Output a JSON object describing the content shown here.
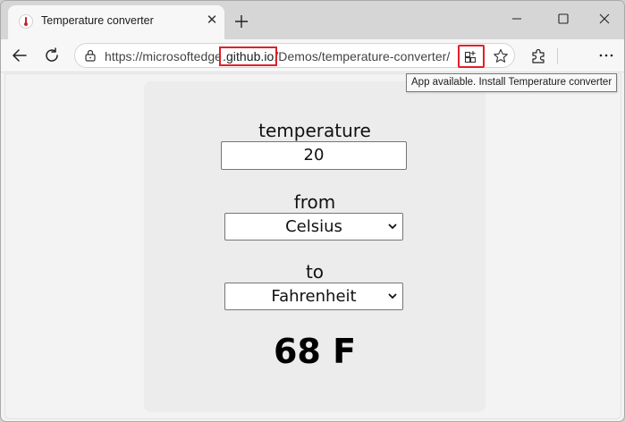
{
  "tab": {
    "title": "Temperature converter",
    "close_glyph": "✕"
  },
  "address": {
    "prefix": "https://microsoftedge",
    "highlight": ".github.io",
    "path": "/Demos/temperature-converter/"
  },
  "tooltip": "App available. Install Temperature converter",
  "form": {
    "temperature_label": "temperature",
    "temperature_value": "20",
    "from_label": "from",
    "from_value": "Celsius",
    "to_label": "to",
    "to_value": "Fahrenheit",
    "result": "68 F"
  },
  "icons": {
    "favicon": "thermometer-icon",
    "close": "close-icon",
    "new_tab": "plus-icon",
    "back": "back-arrow-icon",
    "refresh": "refresh-icon",
    "lock": "lock-icon",
    "app_available": "app-install-icon",
    "favorites": "star-icon",
    "extensions": "puzzle-icon",
    "more": "more-icon"
  },
  "colors": {
    "highlight": "#e0202a",
    "favicon": "#c4262e"
  }
}
